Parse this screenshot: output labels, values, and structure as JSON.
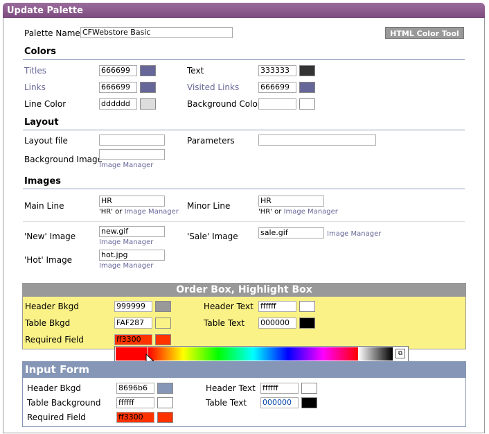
{
  "header": {
    "title": "Update Palette"
  },
  "palette": {
    "name_label": "Palette Name:",
    "name_value": "CFWebstore Basic",
    "color_tool_button": "HTML Color Tool"
  },
  "colors": {
    "title": "Colors",
    "titles_label": "Titles",
    "titles_value": "666699",
    "titles_color": "#666699",
    "text_label": "Text",
    "text_value": "333333",
    "text_color": "#333333",
    "links_label": "Links",
    "links_value": "666699",
    "links_color": "#666699",
    "visited_label": "Visited Links",
    "visited_value": "666699",
    "visited_color": "#666699",
    "linecolor_label": "Line Color",
    "linecolor_value": "dddddd",
    "linecolor_color": "#dddddd",
    "bgcolor_label": "Background Color",
    "bgcolor_value": "",
    "bgcolor_color": "#ffffff"
  },
  "layout": {
    "title": "Layout",
    "layout_file_label": "Layout file",
    "layout_file_value": "",
    "parameters_label": "Parameters",
    "parameters_value": "",
    "bg_image_label": "Background Image",
    "bg_image_value": "",
    "image_manager_link": "Image Manager"
  },
  "images": {
    "title": "Images",
    "main_line_label": "Main Line",
    "main_line_value": "HR",
    "minor_line_label": "Minor Line",
    "minor_line_value": "HR",
    "hr_hint": "'HR' or",
    "image_manager_link": "Image Manager",
    "new_image_label": "'New' Image",
    "new_image_value": "new.gif",
    "sale_image_label": "'Sale' Image",
    "sale_image_value": "sale.gif",
    "hot_image_label": "'Hot' Image",
    "hot_image_value": "hot.jpg"
  },
  "order_box": {
    "title": "Order Box, Highlight Box",
    "header_bkgd_label": "Header Bkgd",
    "header_bkgd_value": "999999",
    "header_bkgd_color": "#999999",
    "header_text_label": "Header Text",
    "header_text_value": "ffffff",
    "header_text_color": "#ffffff",
    "table_bkgd_label": "Table Bkgd",
    "table_bkgd_value": "FAF287",
    "table_bkgd_color": "#FAF287",
    "table_text_label": "Table Text",
    "table_text_value": "000000",
    "table_text_color": "#000000",
    "required_label": "Required Field",
    "required_value": "ff3300",
    "required_color": "#ff3300"
  },
  "input_form": {
    "title": "Input Form",
    "header_bkgd_label": "Header Bkgd",
    "header_bkgd_value": "8696b6",
    "header_bkgd_color": "#8696b6",
    "header_text_label": "Header Text",
    "header_text_value": "ffffff",
    "header_text_color": "#ffffff",
    "table_bg_label": "Table Background",
    "table_bg_value": "ffffff",
    "table_bg_color": "#ffffff",
    "table_text_label": "Table Text",
    "table_text_value": "000000",
    "table_text_color": "#000000",
    "required_label": "Required Field",
    "required_value": "ff3300",
    "required_color": "#ff3300"
  },
  "ui_colors": {
    "header_bar": "#8a5a8c",
    "section_rule": "#8899bb",
    "order_header": "#999999",
    "order_bg": "#FAF287",
    "form_header": "#8696b6"
  }
}
